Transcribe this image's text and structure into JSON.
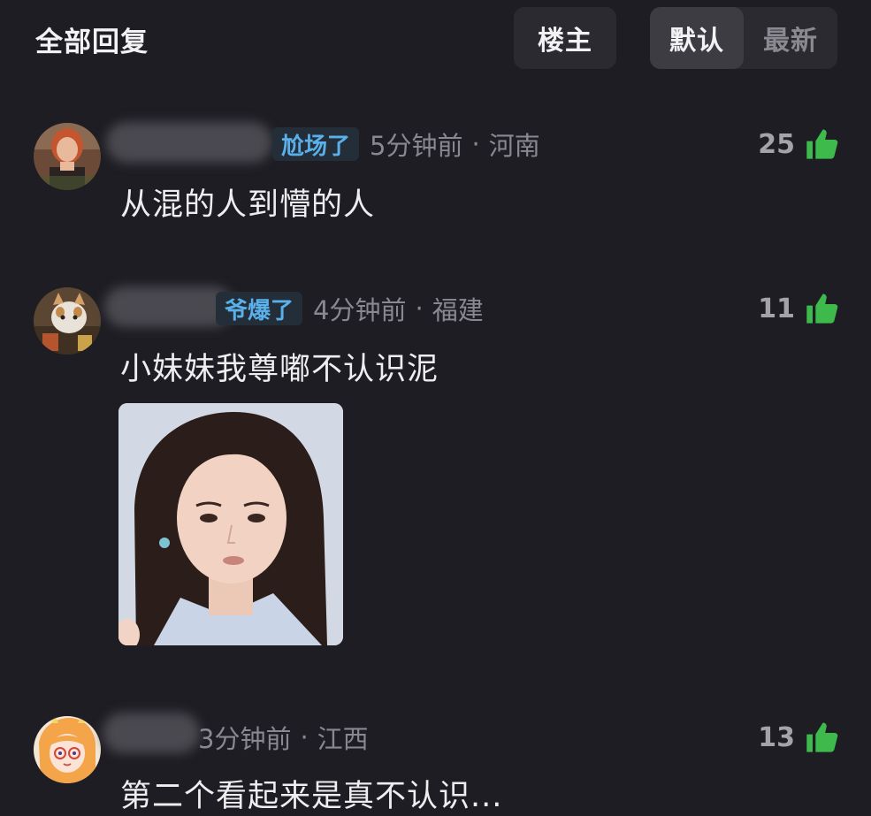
{
  "header": {
    "title": "全部回复",
    "op_label": "楼主",
    "sort_options": [
      "默认",
      "最新"
    ]
  },
  "colors": {
    "background": "#1e1d23",
    "badge_text": "#5ab0ea",
    "like_green": "#3dba4b"
  },
  "comments": [
    {
      "badge": "尬场了",
      "time": "5分钟前",
      "location": "河南",
      "likes": "25",
      "text": "从混的人到懵的人"
    },
    {
      "badge": "爷爆了",
      "time": "4分钟前",
      "location": "福建",
      "likes": "11",
      "text": "小妹妹我尊嘟不认识泥",
      "has_image": true
    },
    {
      "time": "3分钟前",
      "location": "江西",
      "likes": "13",
      "text": "第二个看起来是真不认识..."
    }
  ],
  "icons": {
    "like": "thumbs-up-icon"
  }
}
